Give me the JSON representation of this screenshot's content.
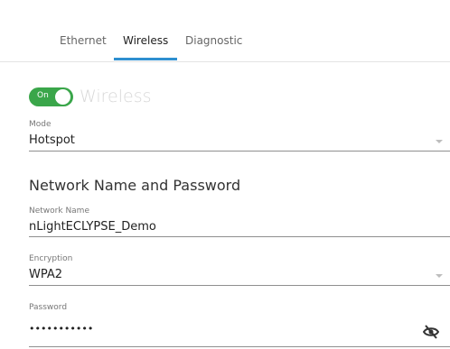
{
  "tabs": [
    {
      "label": "Ethernet"
    },
    {
      "label": "Wireless"
    },
    {
      "label": "Diagnostic"
    }
  ],
  "wireless_toggle": {
    "state_text": "On",
    "label": "Wireless"
  },
  "mode": {
    "label": "Mode",
    "value": "Hotspot"
  },
  "section_title": "Network Name and Password",
  "network_name": {
    "label": "Network Name",
    "value": "nLightECLYPSE_Demo"
  },
  "encryption": {
    "label": "Encryption",
    "value": "WPA2"
  },
  "password": {
    "label": "Password",
    "value": "•••••••••••"
  },
  "colors": {
    "accent": "#2e8fd0",
    "toggle_on": "#3aa64a"
  }
}
